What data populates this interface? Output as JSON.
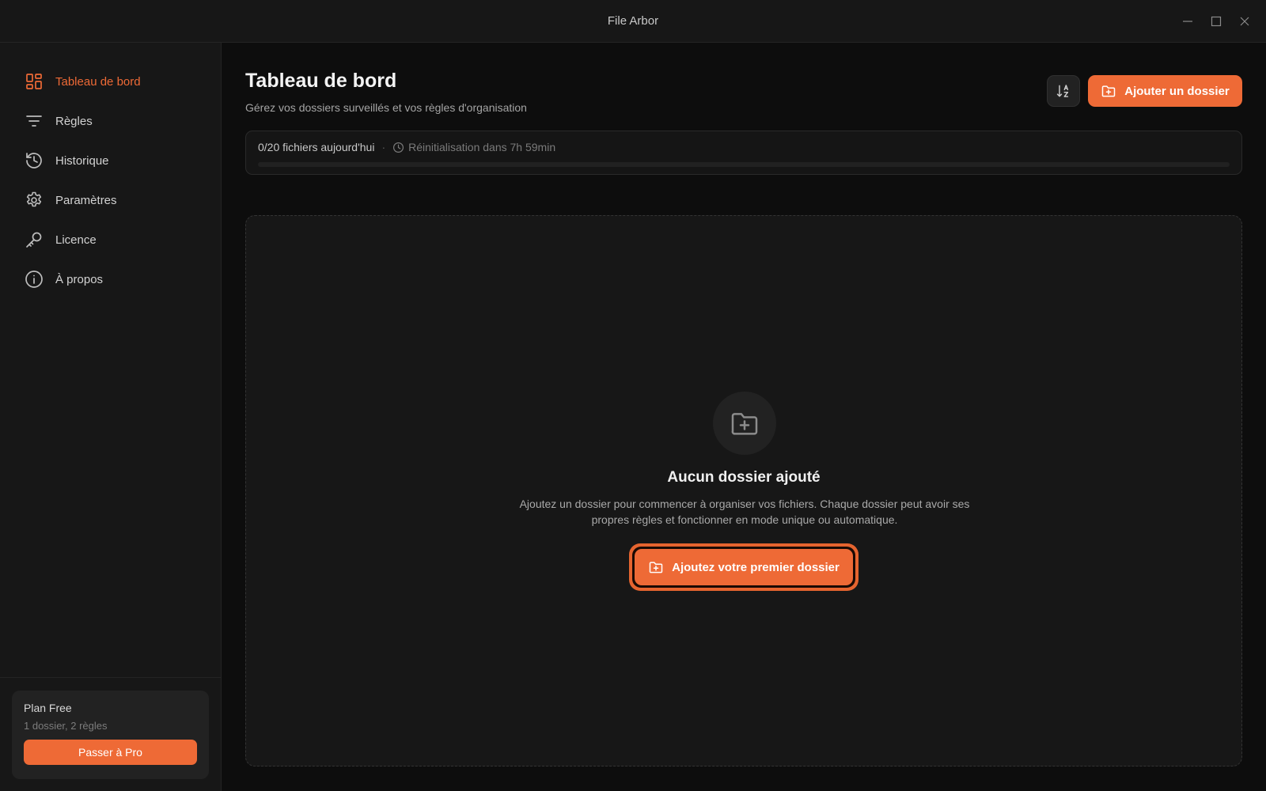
{
  "app": {
    "title": "File Arbor"
  },
  "colors": {
    "accent": "#ee6a36",
    "background": "#0d0d0d",
    "panel": "#171717"
  },
  "sidebar": {
    "items": [
      {
        "label": "Tableau de bord",
        "icon": "dashboard-icon",
        "active": true
      },
      {
        "label": "Règles",
        "icon": "filter-icon"
      },
      {
        "label": "Historique",
        "icon": "history-icon"
      },
      {
        "label": "Paramètres",
        "icon": "gear-icon"
      },
      {
        "label": "Licence",
        "icon": "key-icon"
      },
      {
        "label": "À propos",
        "icon": "info-icon"
      }
    ],
    "plan": {
      "name": "Plan Free",
      "limits": "1 dossier, 2 règles",
      "upgrade_label": "Passer à Pro"
    }
  },
  "header": {
    "title": "Tableau de bord",
    "subtitle": "Gérez vos dossiers surveillés et vos règles d'organisation",
    "add_folder_label": "Ajouter un dossier",
    "sort_icon": "sort-alpha-icon"
  },
  "quota": {
    "count": "0/20 fichiers aujourd'hui",
    "separator": "·",
    "reset": "Réinitialisation dans 7h 59min",
    "progress": 0
  },
  "empty_state": {
    "title": "Aucun dossier ajouté",
    "description": "Ajoutez un dossier pour commencer à organiser vos fichiers. Chaque dossier peut avoir ses propres règles et fonctionner en mode unique ou automatique.",
    "button_label": "Ajoutez votre premier dossier",
    "icon": "folder-plus-icon"
  }
}
